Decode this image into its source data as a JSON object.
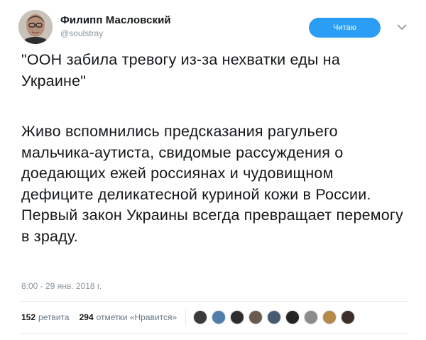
{
  "user": {
    "display_name": "Филипп Масловский",
    "handle": "@soulstray"
  },
  "follow_button": {
    "label": "Читаю"
  },
  "tweet": {
    "paragraph_1": "\"ООН забила тревогу из-за нехватки еды на Украине\"",
    "paragraph_2": "Живо вспомнились предсказания рагульего мальчика-аутиста, свидомые рассуждения о доедающих ежей россиянах и чудовищном дефиците деликатесной куриной кожи в России. Первый закон Украины всегда превращает перемогу в зраду."
  },
  "timestamp": "8:00 - 29 янв. 2018 г.",
  "stats": {
    "retweets_count": "152",
    "retweets_label": "ретвита",
    "likes_count": "294",
    "likes_label": "отметки «Нравится»"
  },
  "colors": {
    "accent": "#2a9df4",
    "text": "#14171a",
    "muted": "#8a959e"
  },
  "liker_avatars": [
    {
      "color": "#3b3b3b"
    },
    {
      "color": "#4f7fa8"
    },
    {
      "color": "#2d2d2d"
    },
    {
      "color": "#6b5a4e"
    },
    {
      "color": "#465a70"
    },
    {
      "color": "#242424"
    },
    {
      "color": "#8c8c8c"
    },
    {
      "color": "#b88a4a"
    },
    {
      "color": "#3d2f2a"
    }
  ]
}
